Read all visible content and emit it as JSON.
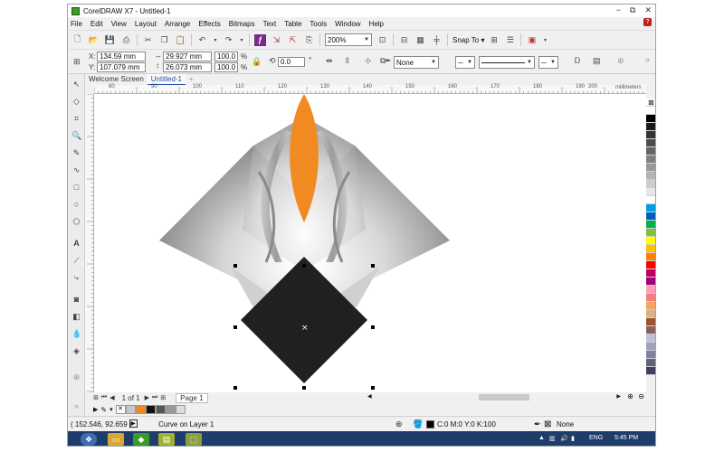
{
  "window": {
    "title": "CorelDRAW X7 - Untitled-1",
    "minimize": "−",
    "restore": "⧉",
    "close": "✕"
  },
  "menu": [
    "File",
    "Edit",
    "View",
    "Layout",
    "Arrange",
    "Effects",
    "Bitmaps",
    "Text",
    "Table",
    "Tools",
    "Window",
    "Help"
  ],
  "standard_toolbar": {
    "zoom": "200%",
    "snap_to": "Snap To"
  },
  "property_bar": {
    "x_label": "X:",
    "x": "134.59 mm",
    "y_label": "Y:",
    "y": "107.079 mm",
    "w": "29.927 mm",
    "h": "26.073 mm",
    "scale_w": "100.0",
    "scale_h": "100.0",
    "pct": "%",
    "rotation": "0.0",
    "degree": "°",
    "outline": "None"
  },
  "tabs": [
    "Welcome Screen",
    "Untitled-1"
  ],
  "ruler": {
    "h_ticks": [
      "80",
      "90",
      "100",
      "110",
      "120",
      "130",
      "140",
      "150",
      "160",
      "170",
      "180",
      "190",
      "200"
    ],
    "units": "millimeters"
  },
  "page_nav": {
    "counter": "1 of 1",
    "page_tab": "Page 1"
  },
  "status": {
    "coords": "( 152.546, 92.659 )",
    "object": "Curve on Layer 1",
    "fill": "C:0 M:0 Y:0 K:100",
    "outline": "None"
  },
  "taskbar": {
    "lang": "ENG",
    "time": "5:45 PM"
  },
  "colors": {
    "orange": "#f28a22",
    "black_diamond": "#202020",
    "palette": [
      "#ffffff",
      "#000000",
      "#1a1a1a",
      "#333333",
      "#4d4d4d",
      "#666666",
      "#808080",
      "#999999",
      "#b3b3b3",
      "#cccccc",
      "#e6e6e6",
      "#ffffff",
      "#00a0e0",
      "#0060c0",
      "#00b050",
      "#80c040",
      "#ffff00",
      "#ffc000",
      "#ff8000",
      "#ff0000",
      "#c00060",
      "#a00080",
      "#ff9fb0",
      "#f08080",
      "#f4a460",
      "#d2b48c",
      "#a0522d",
      "#8b6060",
      "#c0c0d8",
      "#a0a0c0",
      "#8080a0",
      "#606080",
      "#404060"
    ]
  }
}
